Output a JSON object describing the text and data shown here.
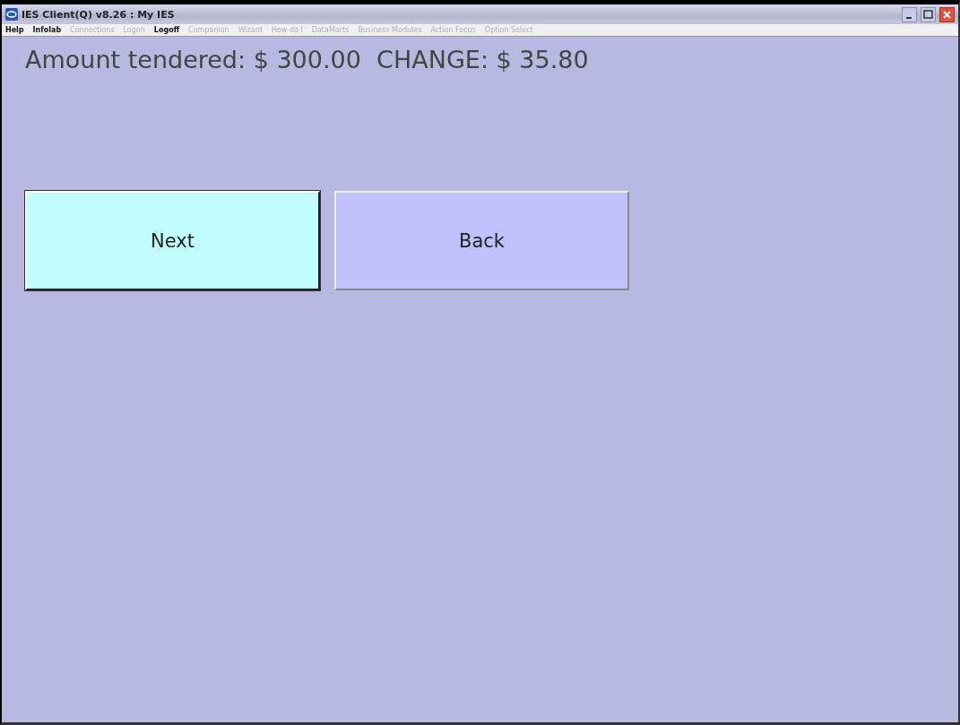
{
  "window": {
    "title": "IES Client(Q) v8.26 : My IES"
  },
  "menu": [
    {
      "label": "Help",
      "disabled": false
    },
    {
      "label": "Infolab",
      "disabled": false
    },
    {
      "label": "Connections",
      "disabled": true
    },
    {
      "label": "Logon",
      "disabled": true
    },
    {
      "label": "Logoff",
      "disabled": false
    },
    {
      "label": "Companion",
      "disabled": true
    },
    {
      "label": "Wizard",
      "disabled": true
    },
    {
      "label": "How do I",
      "disabled": true
    },
    {
      "label": "DataMarts",
      "disabled": true
    },
    {
      "label": "Business Modules",
      "disabled": true
    },
    {
      "label": "Action Focus",
      "disabled": true
    },
    {
      "label": "Option Select",
      "disabled": true
    }
  ],
  "summary": "Amount tendered: $ 300.00  CHANGE: $ 35.80",
  "buttons": [
    {
      "label": "Next",
      "selected": true
    },
    {
      "label": "Back",
      "selected": false
    }
  ]
}
